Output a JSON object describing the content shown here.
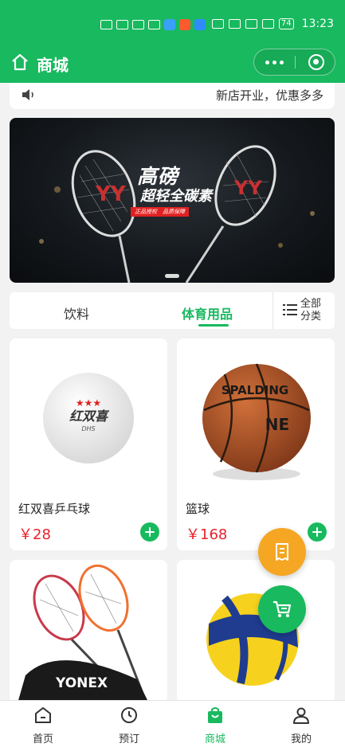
{
  "status_bar": {
    "left_icons": "HD 4G signal wifi app-badges",
    "battery": "74",
    "time": "13:23"
  },
  "header": {
    "title": "商城"
  },
  "notice": {
    "text": "新店开业，优惠多多"
  },
  "banner": {
    "title": "高磅",
    "subtitle": "超轻全碳素",
    "tag": "正品授权　品质保障"
  },
  "tabs": {
    "items": [
      {
        "label": "饮料",
        "active": false
      },
      {
        "label": "体育用品",
        "active": true
      }
    ],
    "all_categories": "全部\n分类"
  },
  "products": [
    {
      "name": "红双喜乒乓球",
      "price": "￥28",
      "ball_brand": "红双喜",
      "ball_sub": "DHS"
    },
    {
      "name": "篮球",
      "price": "￥168",
      "ball_brand": "SPALDING",
      "ball_sub": "NEVER FLAT"
    },
    {
      "name": "",
      "price": "",
      "ball_brand": "YONEX"
    },
    {
      "name": "",
      "price": ""
    }
  ],
  "tabbar": {
    "items": [
      {
        "label": "首页",
        "icon": "home-icon"
      },
      {
        "label": "预订",
        "icon": "clock-icon"
      },
      {
        "label": "商城",
        "icon": "shop-bag-icon",
        "active": true
      },
      {
        "label": "我的",
        "icon": "user-icon"
      }
    ]
  },
  "colors": {
    "brand": "#19b95f",
    "price": "#e8212a",
    "order_fab": "#f5a623"
  }
}
